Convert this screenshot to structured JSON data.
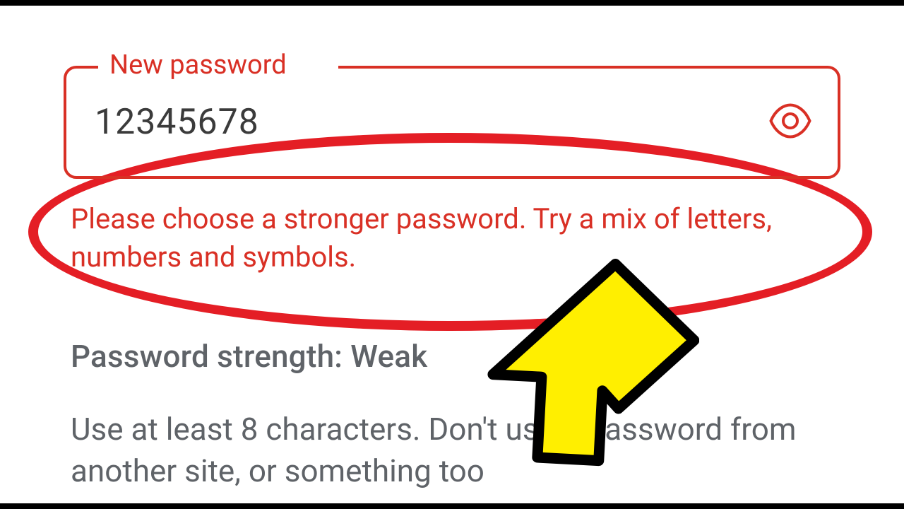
{
  "passwordField": {
    "label": "New password",
    "value": "12345678"
  },
  "errorMessage": "Please choose a stronger password. Try a mix of letters, numbers and symbols.",
  "strength": {
    "label": "Password strength:",
    "value": "Weak"
  },
  "hint": "Use at least 8 characters. Don't use a password from another site, or something too"
}
